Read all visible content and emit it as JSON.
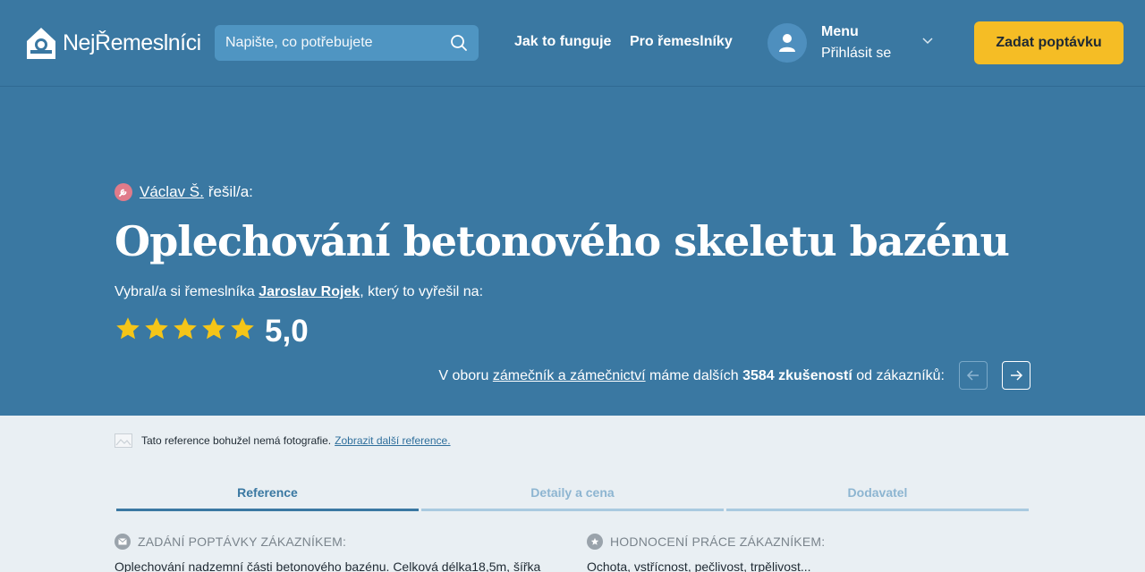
{
  "header": {
    "logo_text": "NejŘemeslníci",
    "search_placeholder": "Napište, co potřebujete",
    "nav": [
      {
        "label": "Jak to funguje"
      },
      {
        "label": "Pro řemeslníky"
      }
    ],
    "menu_title": "Menu",
    "menu_login": "Přihlásit se",
    "cta_label": "Zadat poptávku"
  },
  "hero": {
    "solver_name": "Václav Š.",
    "solver_suffix": "řešil/a:",
    "title": "Oplechování betonového skeletu bazénu",
    "chose_prefix": "Vybral/a si řemeslníka",
    "craftsman_name": "Jaroslav Rojek",
    "chose_suffix": ", který to vyřešil na:",
    "rating": 5.0,
    "rating_text": "5,0",
    "stars_max": 5,
    "more_prefix": "V oboru",
    "more_field": "zámečník a zámečnictví",
    "more_middle": "máme dalších",
    "more_count": "3584 zkušeností",
    "more_suffix": "od zákazníků:"
  },
  "content": {
    "nophoto_text": "Tato reference bohužel nemá fotografie.",
    "nophoto_link": "Zobrazit další reference.",
    "tabs": [
      {
        "label": "Reference"
      },
      {
        "label": "Detaily a cena"
      },
      {
        "label": "Dodavatel"
      }
    ],
    "left_heading": "ZADÁNÍ POPTÁVKY ZÁKAZNÍKEM:",
    "left_text": "Oplechování nadzemní části betonového bazénu. Celková délka18,5m, šířka",
    "right_heading": "HODNOCENÍ PRÁCE ZÁKAZNÍKEM:",
    "right_text": "Ochota, vstřícnost, pečlivost, trpělivost..."
  },
  "colors": {
    "brand": "#3a78a2",
    "accent": "#f5bd25",
    "star": "#f5c518",
    "background": "#e9eff3"
  }
}
